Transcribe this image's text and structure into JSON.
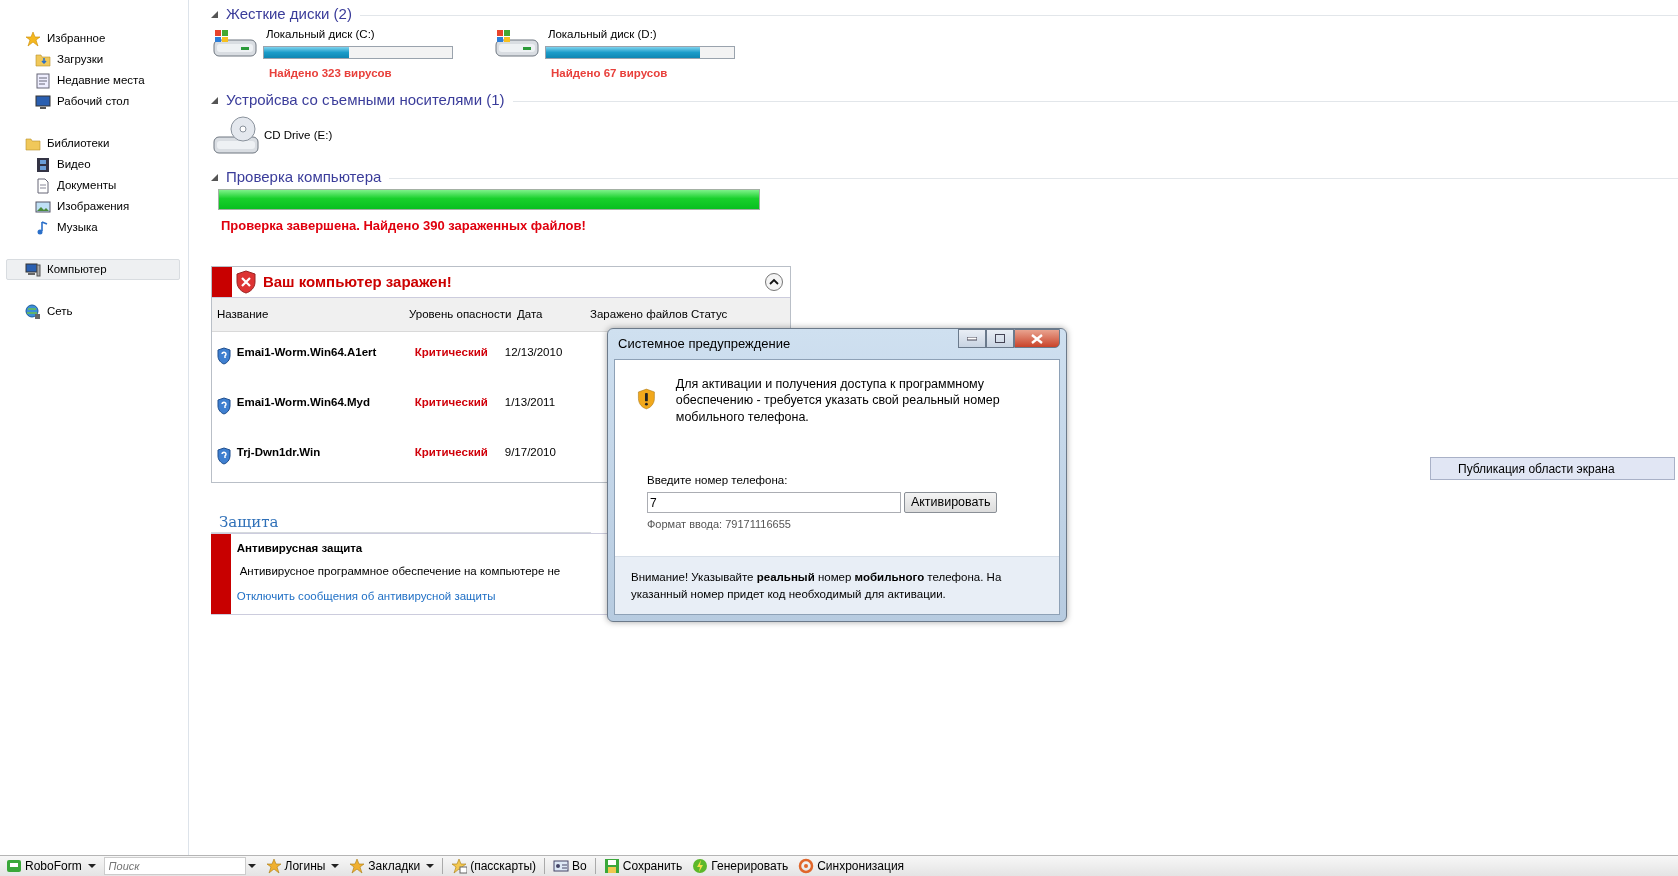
{
  "sidebar": {
    "groups": [
      {
        "label": "Избранное",
        "selected": false,
        "children": [
          {
            "label": "Загрузки",
            "selected": false
          },
          {
            "label": "Недавние места",
            "selected": false
          },
          {
            "label": "Рабочий стол",
            "selected": false
          }
        ]
      },
      {
        "label": "Библиотеки",
        "selected": false,
        "children": [
          {
            "label": "Видео",
            "selected": false
          },
          {
            "label": "Документы",
            "selected": false
          },
          {
            "label": "Изображения",
            "selected": false
          },
          {
            "label": "Музыка",
            "selected": false
          }
        ]
      },
      {
        "label": "Компьютер",
        "selected": true
      },
      {
        "label": "Сеть",
        "selected": false
      }
    ]
  },
  "hard_disks": {
    "heading": "Жесткие диски (2)",
    "expanded": true,
    "drives": [
      {
        "name": "Локальный диск (C:)",
        "level": 0.45,
        "status": "Найдено 323 вирусов"
      },
      {
        "name": "Локальный диск (D:)",
        "level": 0.82,
        "status": "Найдено 67 вирусов"
      }
    ]
  },
  "removable": {
    "heading": "Устройсва со съемными носителями (1)",
    "expanded": true,
    "drives": [
      {
        "name": "CD Drive (E:)"
      }
    ]
  },
  "scan": {
    "heading": "Проверка компьютера",
    "expanded": true,
    "level": 1.0,
    "result": "Проверка завершена. Найдено 390 зараженных файлов!"
  },
  "threats": {
    "title": "Ваш компьютер заражен!",
    "columns": [
      "Название",
      "Уровень опасности",
      "Дата",
      "Заражено файлов",
      "Статус"
    ],
    "rows": [
      {
        "name": "Emai1-Worm.Win64.A1ert",
        "level": "Критический",
        "date": "12/13/2010"
      },
      {
        "name": "Emai1-Worm.Win64.Myd",
        "level": "Критический",
        "date": "1/13/2011"
      },
      {
        "name": "Trj-Dwn1dr.Win",
        "level": "Критический",
        "date": "9/17/2010"
      }
    ]
  },
  "protection": {
    "heading": "Защита",
    "title": "Антивирусная защита",
    "text": "Антивирусное программное обеспечение на компьютере не",
    "link": "Отключить сообщения об антивирусной защиты"
  },
  "dialog": {
    "title": "Системное предупреждение",
    "message": "Для активации и получения доступа к программному обеспечению - требуется указать свой реальный номер мобильного телефона.",
    "phone_label": "Введите номер телефона:",
    "phone_value": "7",
    "button": "Активировать",
    "format_hint": "Формат ввода: 79171116655",
    "notice": "Внимание! Указывайте **реальный** номер **мобильного** телефона. На указанный номер придет код необходимый для активации."
  },
  "popup": {
    "item": "Публикация области экрана"
  },
  "toolbar": {
    "items": [
      {
        "kind": "menu",
        "label": "RoboForm"
      },
      {
        "kind": "search",
        "placeholder": "Поиск"
      },
      {
        "kind": "menu",
        "label": "Логины"
      },
      {
        "kind": "menu",
        "label": "Закладки"
      },
      {
        "kind": "button",
        "label": "(пасскарты)"
      },
      {
        "kind": "button",
        "label": "Во"
      },
      {
        "kind": "button",
        "label": "Сохранить"
      },
      {
        "kind": "button",
        "label": "Генерировать"
      },
      {
        "kind": "button",
        "label": "Синхронизация"
      }
    ]
  }
}
